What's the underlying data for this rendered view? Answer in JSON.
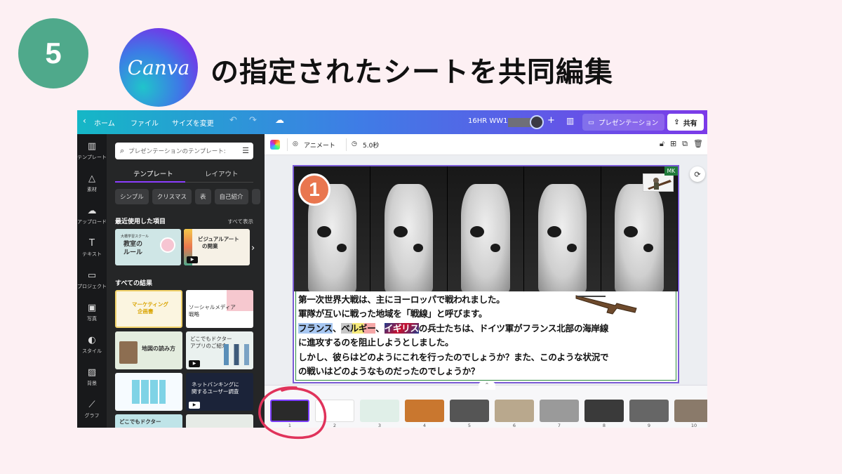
{
  "slide": {
    "step_number": "5",
    "logo_text": "Canva",
    "headline": "の指定されたシートを共同編集"
  },
  "topbar": {
    "back_icon": "chevron-left-icon",
    "home": "ホーム",
    "file": "ファイル",
    "resize": "サイズを変更",
    "title": "16HR WW1",
    "plus": "+",
    "present": "プレゼンテーション",
    "share": "共有"
  },
  "rail": [
    {
      "label": "テンプレート",
      "icon": "▥"
    },
    {
      "label": "素材",
      "icon": "△"
    },
    {
      "label": "アップロード",
      "icon": "☁"
    },
    {
      "label": "テキスト",
      "icon": "T"
    },
    {
      "label": "プロジェクト",
      "icon": "▭"
    },
    {
      "label": "写真",
      "icon": "▣"
    },
    {
      "label": "スタイル",
      "icon": "◐"
    },
    {
      "label": "背景",
      "icon": "▨"
    },
    {
      "label": "グラフ",
      "icon": "⟋"
    }
  ],
  "panel": {
    "search_placeholder": "プレゼンテーションのテンプレート:",
    "tab_templates": "テンプレート",
    "tab_layouts": "レイアウト",
    "chips": [
      "シンプル",
      "クリスマス",
      "表",
      "自己紹介"
    ],
    "recent_title": "最近使用した項目",
    "see_all": "すべて表示",
    "all_results": "すべての結果",
    "recent": [
      {
        "line1": "大橋学習スクール",
        "line2": "教室の",
        "line3": "ルール",
        "bg": "#cfe6e6"
      },
      {
        "line1": "ビジュアルアート",
        "line2": "の開業",
        "bg": "#f6f1e6"
      }
    ],
    "results": [
      {
        "title": "マーケティング",
        "title2": "企画書",
        "bg": "#fbf5e0",
        "color": "#d9a400"
      },
      {
        "title": "ソーシャルメディア",
        "title2": "戦略",
        "bg": "#fbe3e6",
        "color": "#333"
      },
      {
        "title": "地図の読み方",
        "title2": "",
        "bg": "#e4eddf",
        "color": "#333"
      },
      {
        "title": "どこでもドクター",
        "title2": "アプリのご紹介",
        "bg": "#eaf1ef",
        "color": "#333"
      },
      {
        "title": "",
        "title2": "",
        "bg": "#f6fbff",
        "color": "#333"
      },
      {
        "title": "ネットバンキングに",
        "title2": "関するユーザー調査",
        "bg": "#1b2339",
        "color": "#fff"
      },
      {
        "title": "どこでもドクター",
        "title2": "",
        "bg": "#bfe4e8",
        "color": "#333"
      },
      {
        "title": "",
        "title2": "",
        "bg": "#e6ebe6",
        "color": "#333"
      }
    ]
  },
  "editor": {
    "animate": "アニメート",
    "duration": "5.0秒",
    "initials": "MK",
    "badge": "1",
    "text": {
      "line1": "第一次世界大戦は、主にヨーロッパで戦われました。",
      "line2": "軍隊が互いに戦った地域を「戦線」と呼びます。",
      "line3_a": "フランス",
      "line3_b": "、",
      "line3_c": "ベルギー",
      "line3_d": "、",
      "line3_e": "イギリス",
      "line3_f": "の兵士たちは、ドイツ軍がフランス北部の海岸線",
      "line4": "に進攻するのを阻止しようとしました。",
      "line5": "しかし、彼らはどのようにこれを行ったのでしょうか？また、このような状況で",
      "line6": "の戦いはどのようなものだったのでしょうか？"
    }
  },
  "pages": {
    "numbers": [
      "1",
      "2",
      "3",
      "4",
      "5",
      "6",
      "7",
      "8",
      "9",
      "10"
    ],
    "colors": [
      "#2a2a2a",
      "#ffffff",
      "#e0efe8",
      "#c9772f",
      "#555555",
      "#b9a88d",
      "#9a9a9a",
      "#3a3a3a",
      "#666666",
      "#8a7a6a"
    ]
  },
  "colors": {
    "accent": "#7b3dff",
    "badge_green": "#4fa98b",
    "annotation_red": "#e0335b"
  }
}
